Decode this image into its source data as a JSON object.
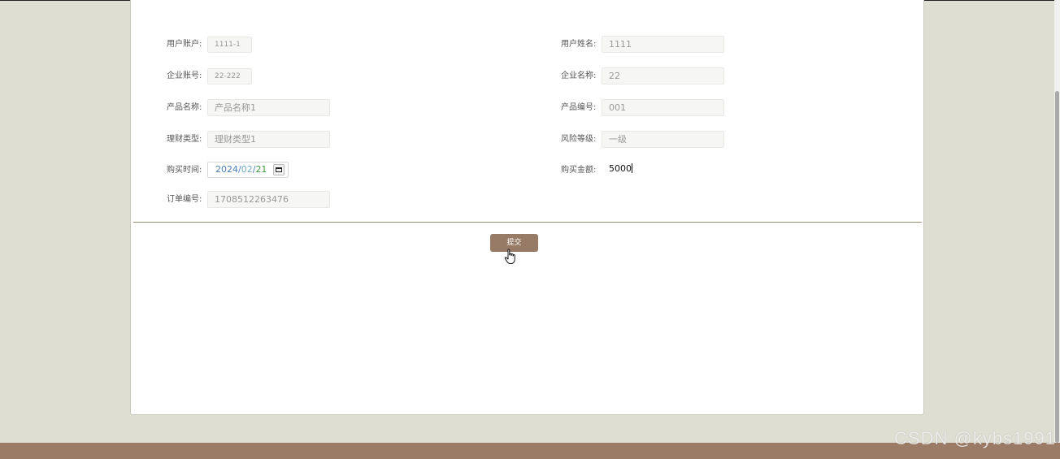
{
  "form": {
    "user_account": {
      "label": "用户账户:",
      "value": "1111-1"
    },
    "user_name": {
      "label": "用户姓名:",
      "value": "1111"
    },
    "company_account": {
      "label": "企业账号:",
      "value": "22-222"
    },
    "company_name": {
      "label": "企业名称:",
      "value": "22"
    },
    "product_name": {
      "label": "产品名称:",
      "value": "产品名称1"
    },
    "product_code": {
      "label": "产品编号:",
      "value": "001"
    },
    "finance_type": {
      "label": "理财类型:",
      "value": "理财类型1"
    },
    "risk_level": {
      "label": "风险等级:",
      "value": "一级"
    },
    "purchase_time": {
      "label": "购买时间:",
      "year": "2024",
      "month": "02",
      "day": "21",
      "sep": "/"
    },
    "purchase_amount": {
      "label": "购买金额:",
      "value": "5000"
    },
    "order_number": {
      "label": "订单编号:",
      "value": "1708512263476"
    }
  },
  "submit_label": "提交",
  "watermark": "CSDN @kybs1991",
  "colors": {
    "accent": "#977b66",
    "footer": "#9b7b66",
    "background": "#dfded3",
    "divider": "#9d8f74"
  }
}
